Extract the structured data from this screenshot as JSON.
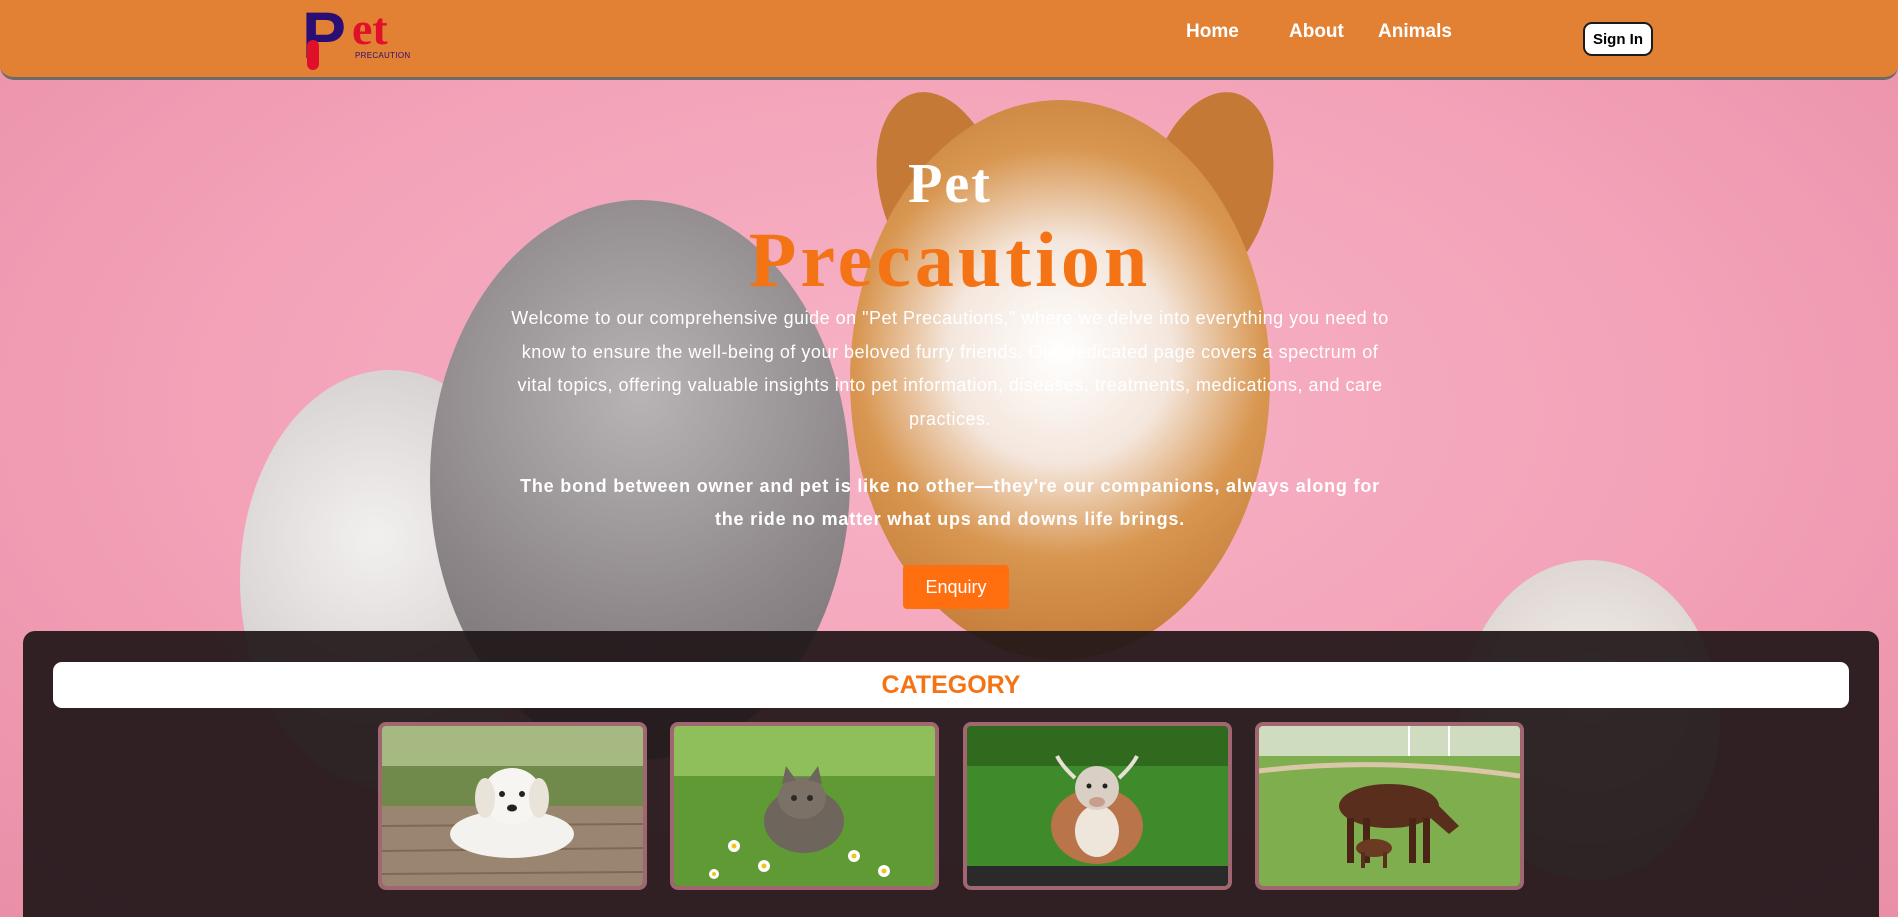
{
  "header": {
    "logo": {
      "letter": "P",
      "text": "et",
      "subtitle": "PRECAUTION"
    },
    "nav": [
      "Home",
      "About",
      "Animals"
    ],
    "signin_label": "Sign In"
  },
  "hero": {
    "title_line1": "Pet",
    "title_line2": "Precaution",
    "paragraph": "Welcome to our comprehensive guide on \"Pet Precautions,\" where we delve into everything you need to know to ensure the well-being of your beloved furry friends. Our dedicated page covers a spectrum of vital topics, offering valuable insights into pet information, diseases, treatments, medications, and care practices.",
    "bond_text": "The bond between owner and pet is like no other—they're our companions, always along for the ride no matter what ups and downs life brings.",
    "enquiry_label": "Enquiry"
  },
  "category": {
    "title": "CATEGORY",
    "cards": [
      {
        "icon": "puppy-image"
      },
      {
        "icon": "kitten-image"
      },
      {
        "icon": "cow-image"
      },
      {
        "icon": "horse-image"
      }
    ]
  },
  "colors": {
    "header_bg": "#e28133",
    "accent": "#f47314",
    "button": "#ff6f0f",
    "hero_pink": "#f5a6bd",
    "panel_bg": "#201618",
    "card_border": "#a06770",
    "logo_purple": "#2a0e74",
    "logo_red": "#e0102a"
  }
}
